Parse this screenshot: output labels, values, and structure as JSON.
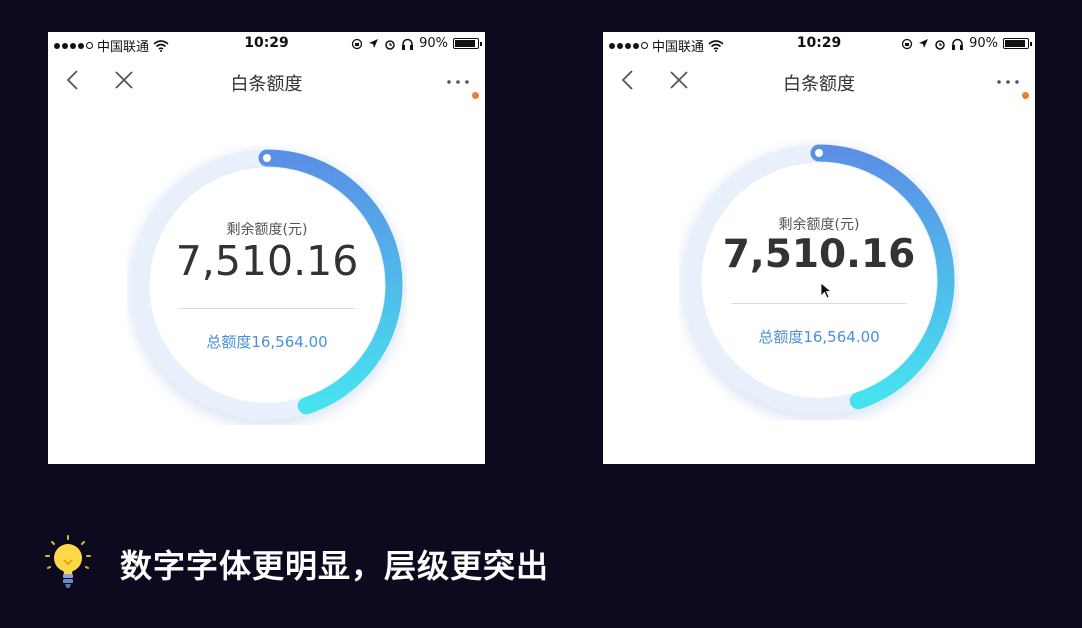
{
  "screens": [
    {
      "status": {
        "carrier": "中国联通",
        "time": "10:29",
        "battery": "90%"
      },
      "nav": {
        "title": "白条额度"
      },
      "card": {
        "label": "剩余额度(元)",
        "amount": "7,510.16",
        "total": "总额度16,564.00"
      },
      "progress": 0.45
    },
    {
      "status": {
        "carrier": "中国联通",
        "time": "10:29",
        "battery": "90%"
      },
      "nav": {
        "title": "白条额度"
      },
      "card": {
        "label": "剩余额度(元)",
        "amount": "7,510.16",
        "total": "总额度16,564.00"
      },
      "progress": 0.45
    }
  ],
  "caption": {
    "text": "数字字体更明显，层级更突出"
  },
  "colors": {
    "arc_start": "#5b8fe6",
    "arc_end": "#46e3ef",
    "track": "#e8f0fb",
    "accent_text": "#4b8fd9",
    "badge": "#f07a2d",
    "background": "#0c0a1f"
  },
  "icons": [
    "signal-icon",
    "wifi-icon",
    "location-icon",
    "alarm-icon",
    "headphones-icon",
    "battery-icon",
    "back-icon",
    "close-icon",
    "more-icon",
    "lightbulb-icon"
  ]
}
